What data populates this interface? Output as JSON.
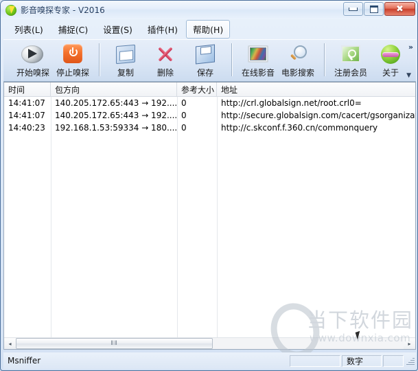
{
  "window": {
    "title": "影音嗅探专家 - V2016",
    "icon": "lightning-bolt-icon",
    "minimize_label": "最小化",
    "maximize_label": "最大化",
    "close_label": "关闭"
  },
  "menu": {
    "items": [
      {
        "label": "列表(L)",
        "name": "menu-list",
        "active": false
      },
      {
        "label": "捕捉(C)",
        "name": "menu-capture",
        "active": false
      },
      {
        "label": "设置(S)",
        "name": "menu-settings",
        "active": false
      },
      {
        "label": "插件(H)",
        "name": "menu-plugins",
        "active": false
      },
      {
        "label": "帮助(H)",
        "name": "menu-help",
        "active": true
      }
    ]
  },
  "toolbar": {
    "buttons": [
      {
        "label": "开始嗅探",
        "icon": "radar-disc-icon",
        "name": "start-sniff"
      },
      {
        "label": "停止嗅探",
        "icon": "power-stop-icon",
        "name": "stop-sniff"
      },
      {
        "label": "复制",
        "icon": "copy-icon",
        "name": "copy"
      },
      {
        "label": "删除",
        "icon": "delete-x-icon",
        "name": "delete"
      },
      {
        "label": "保存",
        "icon": "floppy-save-icon",
        "name": "save"
      },
      {
        "label": "在线影音",
        "icon": "tv-monitor-icon",
        "name": "online-media"
      },
      {
        "label": "电影搜索",
        "icon": "magnifier-icon",
        "name": "movie-search"
      },
      {
        "label": "注册会员",
        "icon": "register-key-icon",
        "name": "register-member"
      },
      {
        "label": "关于",
        "icon": "smiley-sunglasses-icon",
        "name": "about"
      }
    ],
    "overflow_label": "»",
    "dropdown_label": "▼"
  },
  "list": {
    "columns": [
      {
        "label": "时间",
        "name": "column-time"
      },
      {
        "label": "包方向",
        "name": "column-direction"
      },
      {
        "label": "参考大小",
        "name": "column-size"
      },
      {
        "label": "地址",
        "name": "column-address"
      }
    ],
    "rows": [
      {
        "time": "14:41:07",
        "direction": "140.205.172.65:443 → 192....",
        "size": "0",
        "address": "http://crl.globalsign.net/root.crl0="
      },
      {
        "time": "14:41:07",
        "direction": "140.205.172.65:443 → 192....",
        "size": "0",
        "address": "http://secure.globalsign.com/cacert/gsorganizati"
      },
      {
        "time": "14:40:23",
        "direction": "192.168.1.53:59334 → 180....",
        "size": "0",
        "address": "http://c.skconf.f.360.cn/commonquery"
      }
    ]
  },
  "scrollbar": {
    "left_arrow": "◂",
    "right_arrow": "▸",
    "thumb_grip": "ⅡⅡ"
  },
  "statusbar": {
    "main_text": "Msniffer",
    "pane_numeric": "数字"
  },
  "watermark": {
    "site_name": "当下软件园",
    "site_url": "www.downxia.com"
  }
}
